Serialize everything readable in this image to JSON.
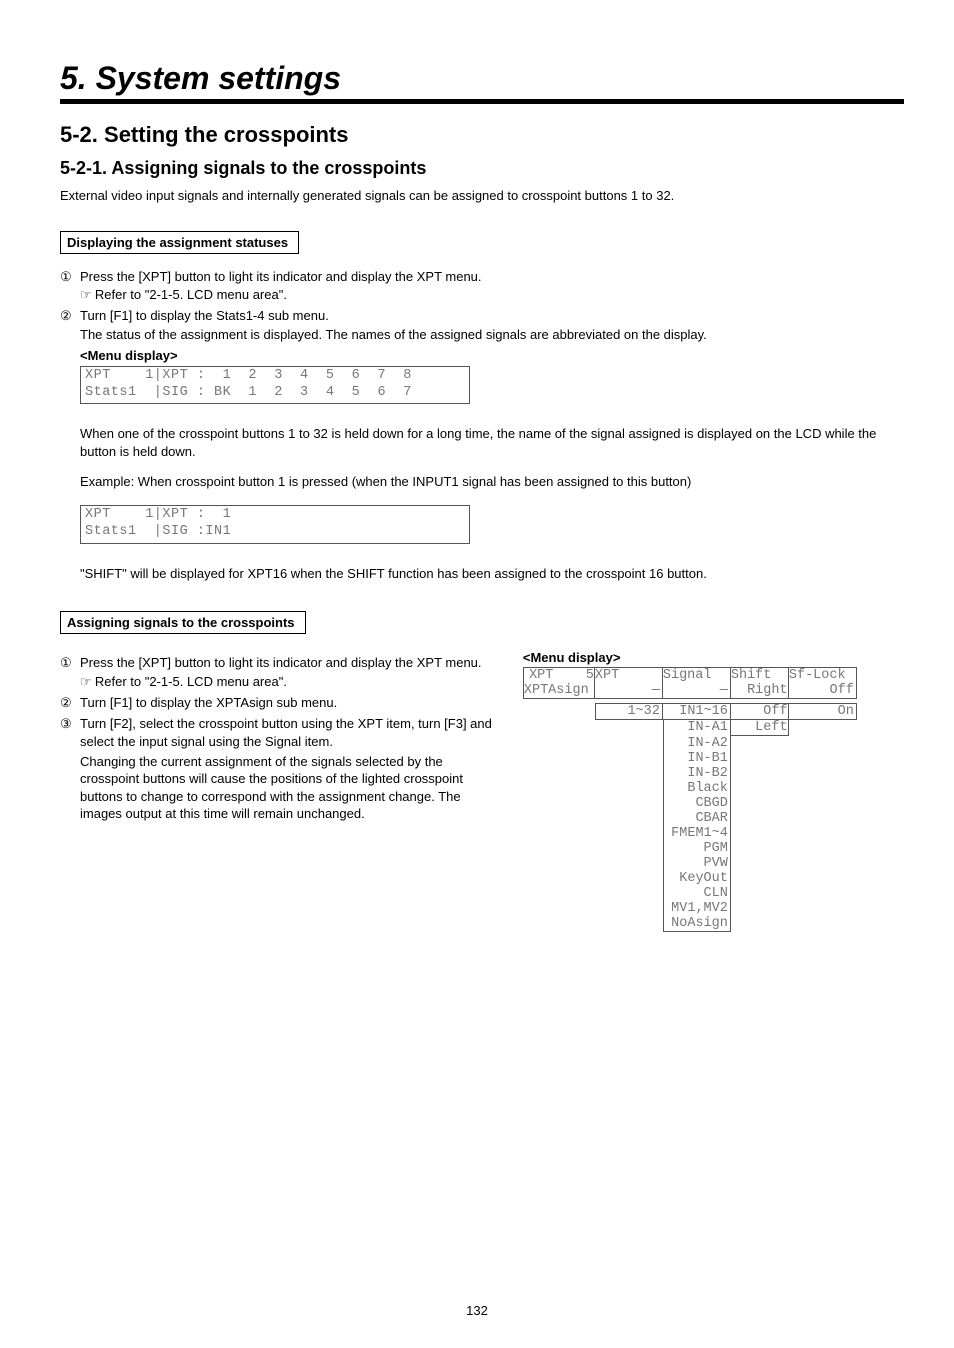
{
  "chapter": "5. System settings",
  "sec52": "5-2. Setting the crosspoints",
  "sub521": "5-2-1.  Assigning signals to the crosspoints",
  "intro": "External video input signals and internally generated signals can be assigned to crosspoint buttons 1 to 32.",
  "box1": "Displaying the assignment statuses",
  "s1n": "①",
  "s1t": "Press the [XPT] button to light its indicator and display the XPT menu.",
  "ref1": "Refer to \"2-1-5. LCD menu area\".",
  "s2n": "②",
  "s2t": "Turn [F1] to display the Stats1-4 sub menu.",
  "s2b": "The status of the assignment is displayed. The names of the assigned signals are abbreviated on the display.",
  "menuHead1": "<Menu display>",
  "monoA1": "XPT    1|XPT :  1  2  3  4  5  6  7  8",
  "monoA2": "Stats1  |SIG : BK  1  2  3  4  5  6  7",
  "paraHold": "When one of the crosspoint buttons 1 to 32 is held down for a long time, the name of the signal assigned is displayed on the LCD while the button is held down.",
  "paraEx": "Example: When crosspoint button 1 is pressed (when the INPUT1 signal has been assigned to this button)",
  "monoB1": "XPT    1|XPT :  1",
  "monoB2": "Stats1  |SIG :IN1",
  "shiftNote": "\"SHIFT\" will be displayed for XPT16 when the SHIFT function has been assigned to the crosspoint 16 button.",
  "box2": "Assigning signals to the crosspoints",
  "left": {
    "s1": "Press the [XPT] button to light its indicator and display the XPT menu.",
    "ref": "Refer to \"2-1-5. LCD menu area\".",
    "s2": "Turn [F1] to display the XPTAsign sub menu.",
    "s3": "Turn [F2], select the crosspoint button using the XPT item, turn [F3] and select the input signal using the Signal item.",
    "s3b": "Changing the current assignment of the signals selected by the crosspoint buttons will cause the positions of the lighted crosspoint buttons to change to correspond with the assignment change.  The images output at this time will remain unchanged."
  },
  "right": {
    "head": "<Menu display>",
    "r1": {
      "c0": "XPT    5",
      "c1": "XPT    ",
      "c2": "Signal ",
      "c3": "Shift  ",
      "c4": "Sf-Lock"
    },
    "r2": {
      "c0": "XPTAsign",
      "c1": "      —",
      "c2": "      —",
      "c3": "  Right",
      "c4": "    Off"
    },
    "body": {
      "c1": "   1~32",
      "c2": " IN1~16",
      "c3": "    Off",
      "c4": "     On"
    },
    "sigList": [
      "  IN-A1",
      "  IN-A2",
      "  IN-B1",
      "  IN-B2",
      "  Black",
      "   CBGD",
      "   CBAR",
      "FMEM1~4",
      "    PGM",
      "    PVW",
      " KeyOut",
      "    CLN",
      "MV1,MV2",
      "NoAsign"
    ],
    "shiftExtra": "   Left"
  },
  "pageNum": "132"
}
